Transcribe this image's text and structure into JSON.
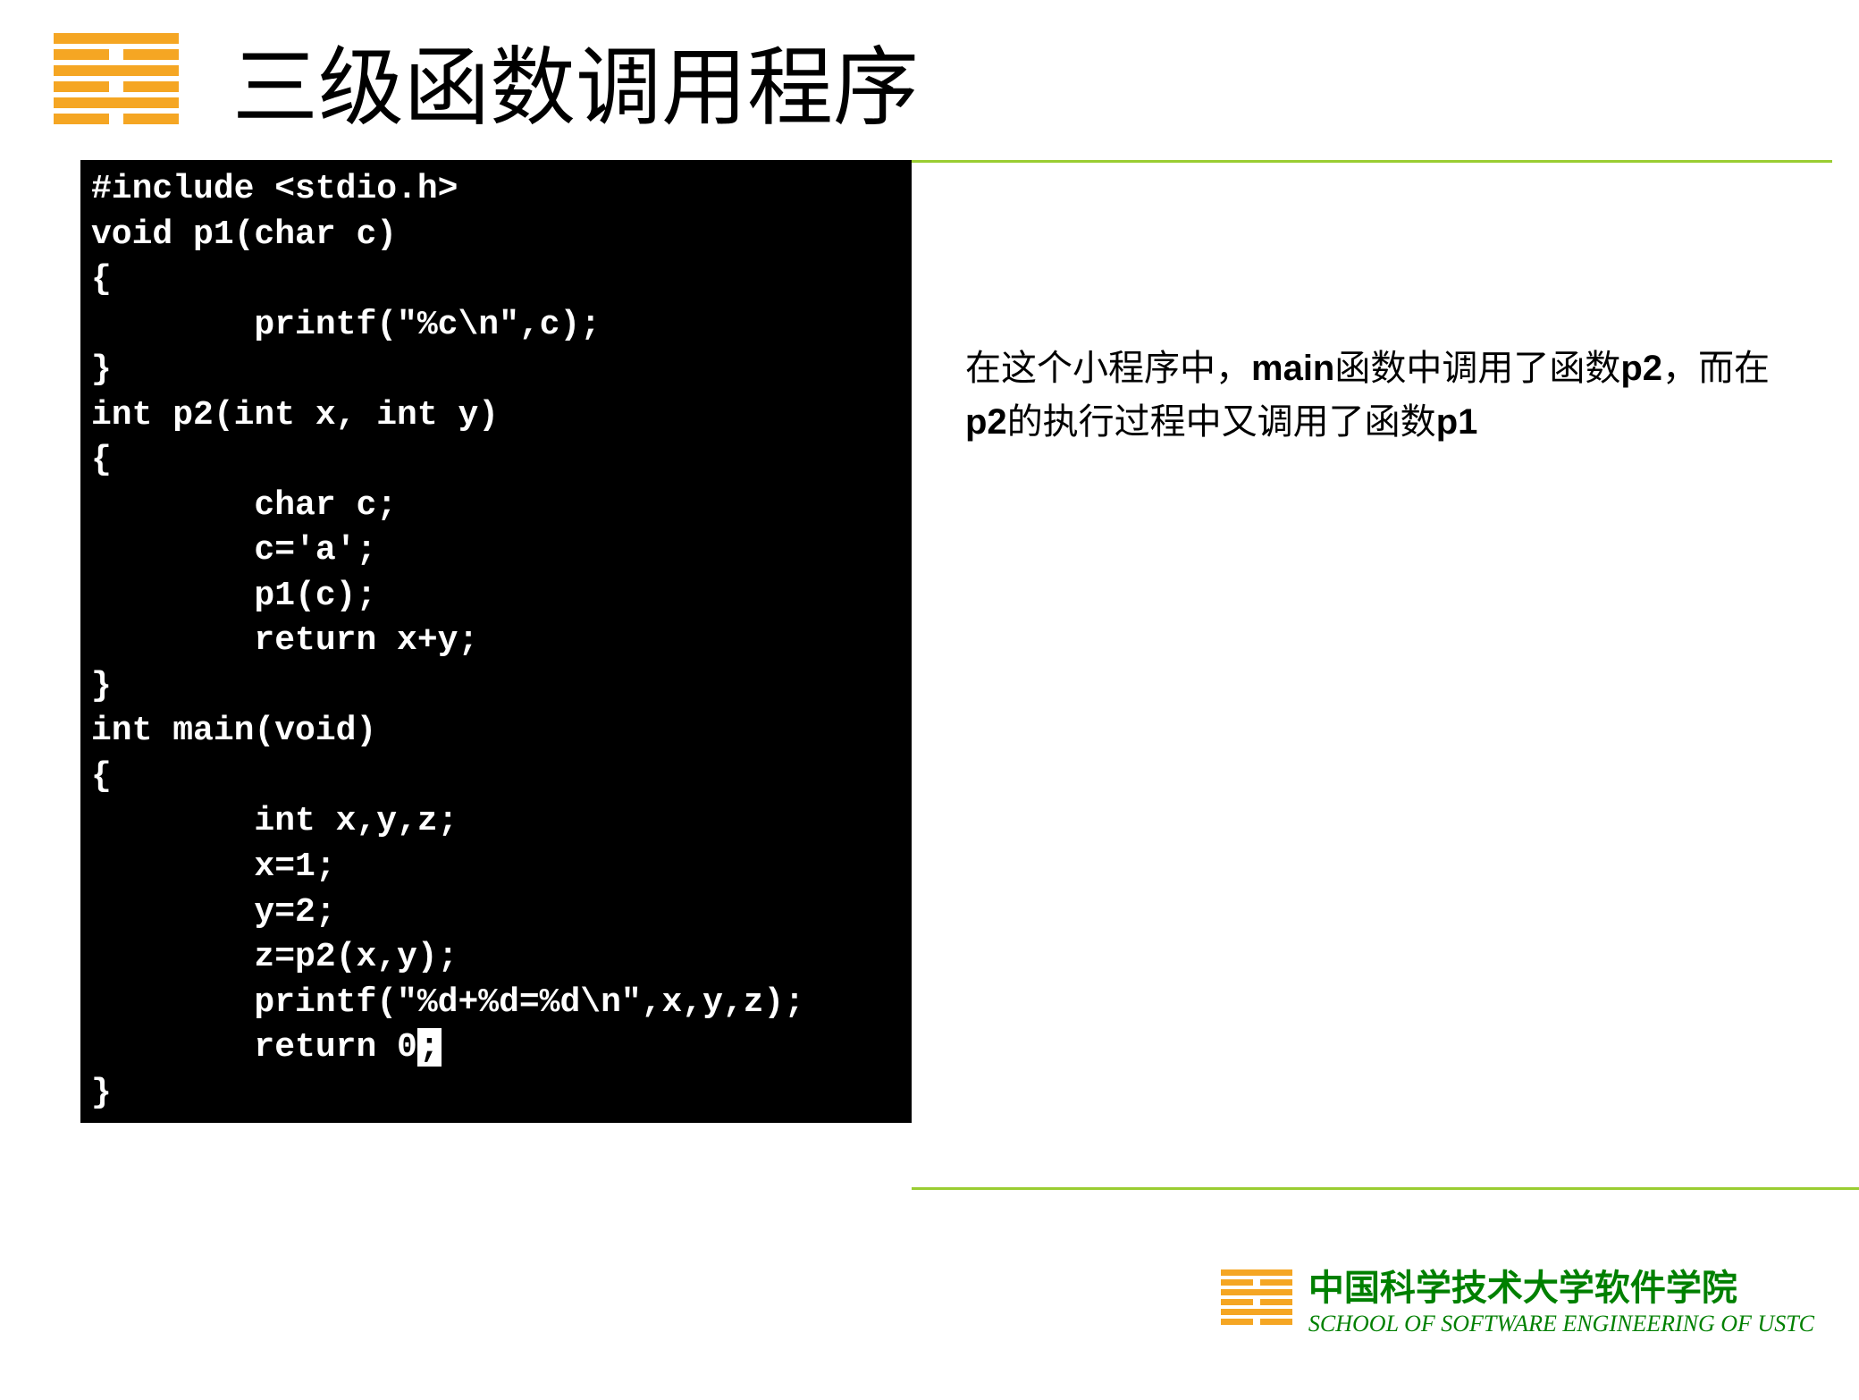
{
  "header": {
    "title": "三级函数调用程序"
  },
  "code": {
    "line01": "#include <stdio.h>",
    "line02": "void p1(char c)",
    "line03": "{",
    "line04": "        printf(\"%c\\n\",c);",
    "line05": "}",
    "line06": "int p2(int x, int y)",
    "line07": "{",
    "line08": "        char c;",
    "line09": "        c='a';",
    "line10": "        p1(c);",
    "line11": "        return x+y;",
    "line12": "}",
    "line13": "int main(void)",
    "line14": "{",
    "line15": "        int x,y,z;",
    "line16": "        x=1;",
    "line17": "        y=2;",
    "line18": "        z=p2(x,y);",
    "line19": "        printf(\"%d+%d=%d\\n\",x,y,z);",
    "line20_pre": "        return 0",
    "line20_cursor": ";",
    "line21": "}"
  },
  "description": {
    "part1": "在这个小程序中，",
    "bold1": "main",
    "part2": "函数中调用了函数",
    "bold2": "p2",
    "part3": "，而在",
    "bold3": "p2",
    "part4": "的执行过程中又调用了函数",
    "bold4": "p1"
  },
  "footer": {
    "school_cn": "中国科学技术大学软件学院",
    "school_en": "SCHOOL OF SOFTWARE ENGINEERING OF USTC"
  }
}
